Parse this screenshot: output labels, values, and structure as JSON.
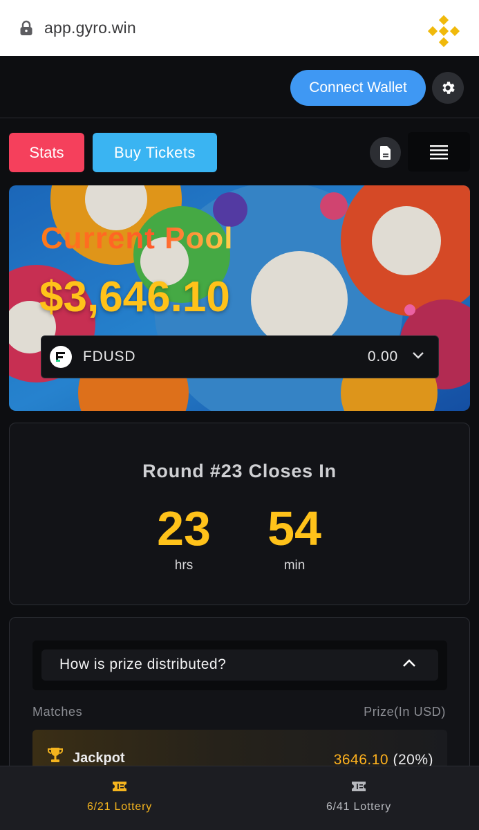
{
  "browser": {
    "url": "app.gyro.win"
  },
  "header": {
    "connect_label": "Connect Wallet"
  },
  "actions": {
    "stats_label": "Stats",
    "buy_label": "Buy Tickets"
  },
  "pool": {
    "title": "Current Pool",
    "amount": "$3,646.10",
    "token": {
      "name": "FDUSD",
      "value": "0.00"
    }
  },
  "round": {
    "title": "Round #23 Closes In",
    "hours": "23",
    "hours_unit": "hrs",
    "minutes": "54",
    "minutes_unit": "min"
  },
  "prize": {
    "question": "How is prize distributed?",
    "col_matches": "Matches",
    "col_prize": "Prize(In USD)",
    "jackpot": {
      "label": "Jackpot",
      "amount": "3646.10",
      "percent": "(20%)"
    }
  },
  "nav": [
    {
      "label": "6/21 Lottery",
      "active": true
    },
    {
      "label": "6/41 Lottery",
      "active": false
    }
  ],
  "colors": {
    "accent_blue": "#3f98f3",
    "stats_red": "#f5405c",
    "buy_blue": "#3ab4f2",
    "gold": "#ffc21a",
    "nav_active": "#f4b41e"
  }
}
